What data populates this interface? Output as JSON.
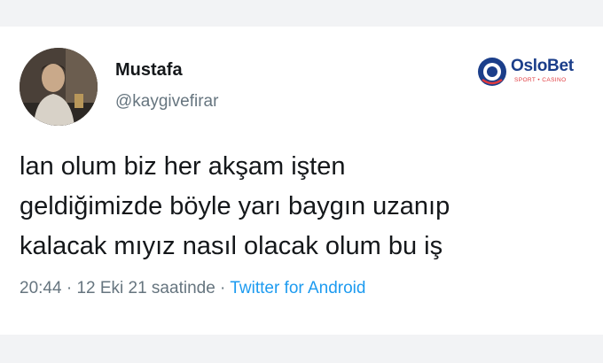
{
  "user": {
    "display_name": "Mustafa",
    "handle": "@kaygivefirar",
    "avatar_icon": "profile-photo"
  },
  "brand": {
    "name_part1": "Oslo",
    "name_part2": "Bet",
    "tagline": "SPORT • CASINO",
    "colors": {
      "primary": "#1b3e8a",
      "accent": "#e03a3e"
    }
  },
  "tweet": {
    "lines": [
      "lan olum biz her akşam işten",
      "geldiğimizde böyle yarı baygın uzanıp",
      "kalacak mıyız nasıl olacak olum bu iş"
    ]
  },
  "meta": {
    "time": "20:44",
    "separator": " · ",
    "date": "12 Eki 21 saatinde",
    "source": "Twitter for Android",
    "source_color": "#1d9bf0"
  }
}
